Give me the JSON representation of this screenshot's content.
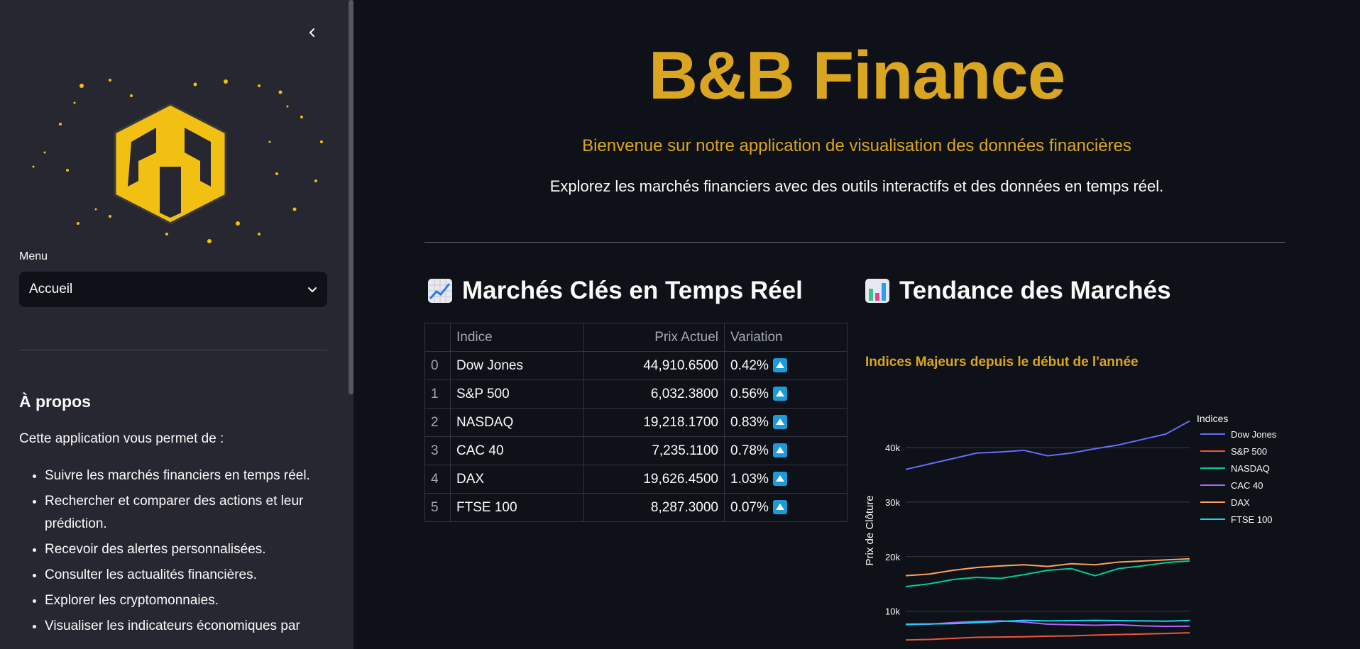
{
  "sidebar": {
    "menu_label": "Menu",
    "menu_value": "Accueil",
    "about_title": "À propos",
    "about_intro": "Cette application vous permet de :",
    "about_items": [
      "Suivre les marchés financiers en temps réel.",
      "Rechercher et comparer des actions et leur prédiction.",
      "Recevoir des alertes personnalisées.",
      "Consulter les actualités financières.",
      "Explorer les cryptomonnaies.",
      "Visualiser les indicateurs économiques par"
    ],
    "logo_color": "#F2C012"
  },
  "header": {
    "title": "B&B Finance",
    "subtitle": "Bienvenue sur notre application de visualisation des données financières",
    "tagline": "Explorez les marchés financiers avec des outils interactifs et des données en temps réel.",
    "accent": "#DAA520"
  },
  "markets": {
    "heading": "Marchés Clés en Temps Réel",
    "heading_icon": "chart-increasing-icon",
    "columns": [
      "",
      "Indice",
      "Prix Actuel",
      "Variation"
    ],
    "rows": [
      {
        "idx": "0",
        "name": "Dow Jones",
        "price": "44,910.6500",
        "variation": "0.42%"
      },
      {
        "idx": "1",
        "name": "S&P 500",
        "price": "6,032.3800",
        "variation": "0.56%"
      },
      {
        "idx": "2",
        "name": "NASDAQ",
        "price": "19,218.1700",
        "variation": "0.83%"
      },
      {
        "idx": "3",
        "name": "CAC 40",
        "price": "7,235.1100",
        "variation": "0.78%"
      },
      {
        "idx": "4",
        "name": "DAX",
        "price": "19,626.4500",
        "variation": "1.03%"
      },
      {
        "idx": "5",
        "name": "FTSE 100",
        "price": "8,287.3000",
        "variation": "0.07%"
      }
    ],
    "up_icon": "up-button-icon"
  },
  "trend": {
    "heading": "Tendance des Marchés",
    "heading_icon": "bar-chart-icon",
    "chart_title": "Indices Majeurs depuis le début de l'année"
  },
  "chart_data": {
    "type": "line",
    "title": "Indices Majeurs depuis le début de l'année",
    "xlabel": "",
    "ylabel": "Prix de Clôture",
    "ylim": [
      5000,
      46000
    ],
    "yticks": [
      10000,
      20000,
      30000,
      40000
    ],
    "ytick_labels": [
      "10k",
      "20k",
      "30k",
      "40k"
    ],
    "grid": true,
    "legend_title": "Indices",
    "legend_position": "right",
    "x": [
      0,
      1,
      2,
      3,
      4,
      5,
      6,
      7,
      8,
      9,
      10,
      11,
      12
    ],
    "series": [
      {
        "name": "Dow Jones",
        "color": "#636efa",
        "values": [
          36000,
          37000,
          38000,
          39000,
          39200,
          39500,
          38500,
          39000,
          39800,
          40500,
          41500,
          42500,
          44900
        ]
      },
      {
        "name": "S&P 500",
        "color": "#ef553b",
        "values": [
          4700,
          4800,
          5000,
          5200,
          5250,
          5300,
          5400,
          5450,
          5600,
          5700,
          5800,
          5900,
          6030
        ]
      },
      {
        "name": "NASDAQ",
        "color": "#00cc96",
        "values": [
          14500,
          15000,
          15800,
          16200,
          16000,
          16700,
          17500,
          17800,
          16500,
          17800,
          18300,
          18900,
          19200
        ]
      },
      {
        "name": "CAC 40",
        "color": "#ab63fa",
        "values": [
          7500,
          7600,
          7900,
          8100,
          8200,
          8000,
          7600,
          7500,
          7400,
          7500,
          7300,
          7200,
          7235
        ]
      },
      {
        "name": "DAX",
        "color": "#ffa15a",
        "values": [
          16500,
          16800,
          17500,
          18000,
          18300,
          18500,
          18200,
          18700,
          18500,
          19000,
          19200,
          19400,
          19600
        ]
      },
      {
        "name": "FTSE 100",
        "color": "#19d3f3",
        "values": [
          7600,
          7650,
          7700,
          7900,
          8100,
          8300,
          8200,
          8250,
          8300,
          8250,
          8200,
          8150,
          8290
        ]
      }
    ]
  }
}
